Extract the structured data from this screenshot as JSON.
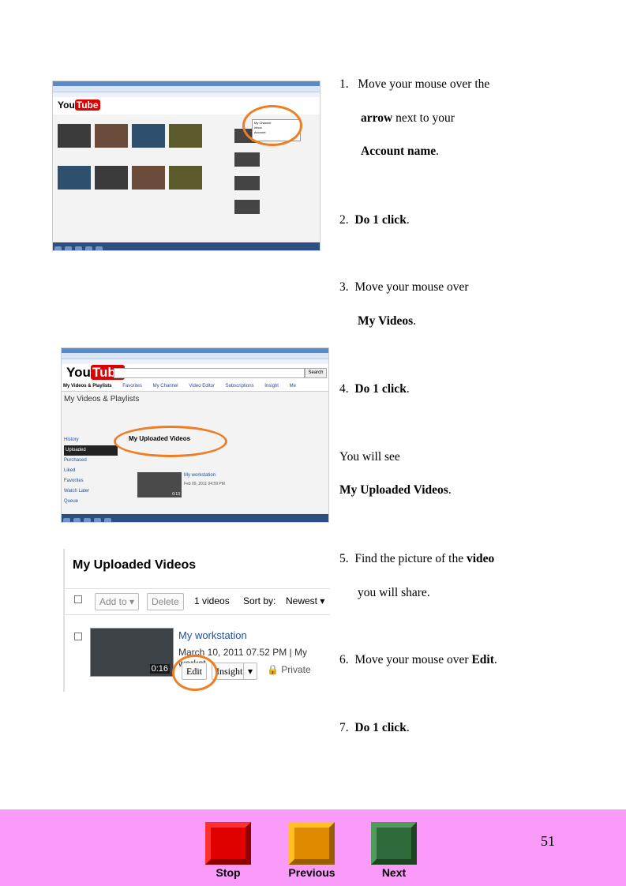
{
  "screenshots": {
    "one": {
      "logo_you": "You",
      "logo_tube": "Tube",
      "dropdown_items": [
        "My Channel",
        "Subscriptions",
        "Inbox",
        "My Videos",
        "Account",
        "Favorites"
      ]
    },
    "two": {
      "logo_you": "You",
      "logo_tube": "Tube",
      "search_button": "Search",
      "nav": [
        "My Videos & Playlists",
        "Favorites",
        "My Channel",
        "Video Editor",
        "Subscriptions",
        "Insight",
        "Me"
      ],
      "section_title": "My Videos & Playlists",
      "left_nav": [
        "History",
        "Uploaded",
        "Purchased",
        "Liked",
        "Favorites",
        "Watch Later",
        "Queue"
      ],
      "uploaded_heading": "My Uploaded Videos",
      "video_name": "My workstation",
      "video_meta": "Feb 09, 2011 04:59 PM",
      "video_duration": "0:13"
    },
    "three": {
      "title": "My Uploaded Videos",
      "add_to": "Add to",
      "delete": "Delete",
      "videos_count": "1 videos",
      "sort_by": "Sort by:",
      "sort_value": "Newest",
      "video_name": "My workstation",
      "video_date": "March 10, 2011 07.52 PM",
      "video_channel": "My workst",
      "duration": "0:16",
      "edit": "Edit",
      "insight": "Insight",
      "privacy": "Private"
    }
  },
  "steps": {
    "s1_num": "1.",
    "s1_a": "Move your mouse over the",
    "s1_b_bold": "arrow",
    "s1_b_rest": "next to your",
    "s1_c_bold": "Account name",
    "s1_c_rest": ".",
    "s2_num": "2.",
    "s2_bold": "Do  1  click",
    "s2_rest": ".",
    "s3_num": "3.",
    "s3_a": "Move your mouse over",
    "s3_b_bold": "My Videos",
    "s3_b_rest": ".",
    "s4_num": "4.",
    "s4_bold": "Do  1  click",
    "s4_rest": ".",
    "see_a": "You will see",
    "see_b_bold": "My Uploaded Videos",
    "see_b_rest": ".",
    "s5_num": "5.",
    "s5_a": "Find the picture of the",
    "s5_a_bold": "video",
    "s5_b": "you will share.",
    "s6_num": "6.",
    "s6_a": "Move your mouse over",
    "s6_bold": "Edit",
    "s6_rest": ".",
    "s7_num": "7.",
    "s7_bold": "Do  1  click",
    "s7_rest": "."
  },
  "footer": {
    "stop": "Stop",
    "previous": "Previous",
    "next": "Next",
    "page_number": "51"
  },
  "colors": {
    "footer_bg": "#fa9bfa",
    "highlight_ring": "#ef7d22",
    "stop": "#e00000",
    "previous": "#e08a00",
    "next": "#2e6a3a"
  }
}
